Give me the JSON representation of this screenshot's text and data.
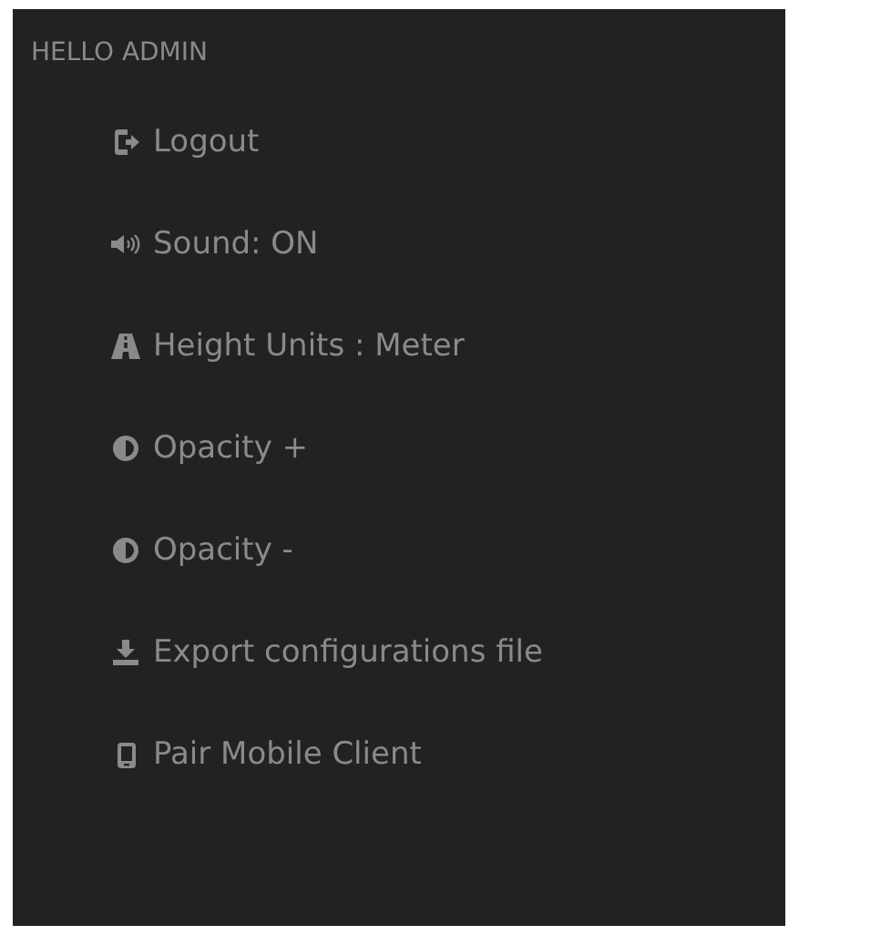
{
  "greeting": "HELLO ADMIN",
  "items": [
    {
      "kind": "logout",
      "label": "Logout"
    },
    {
      "kind": "sound",
      "label": "Sound: ON"
    },
    {
      "kind": "road",
      "label": "Height Units : Meter"
    },
    {
      "kind": "contrast",
      "label": "Opacity +"
    },
    {
      "kind": "contrast",
      "label": "Opacity -"
    },
    {
      "kind": "download",
      "label": "Export configurations file"
    },
    {
      "kind": "mobile",
      "label": "Pair Mobile Client"
    }
  ]
}
